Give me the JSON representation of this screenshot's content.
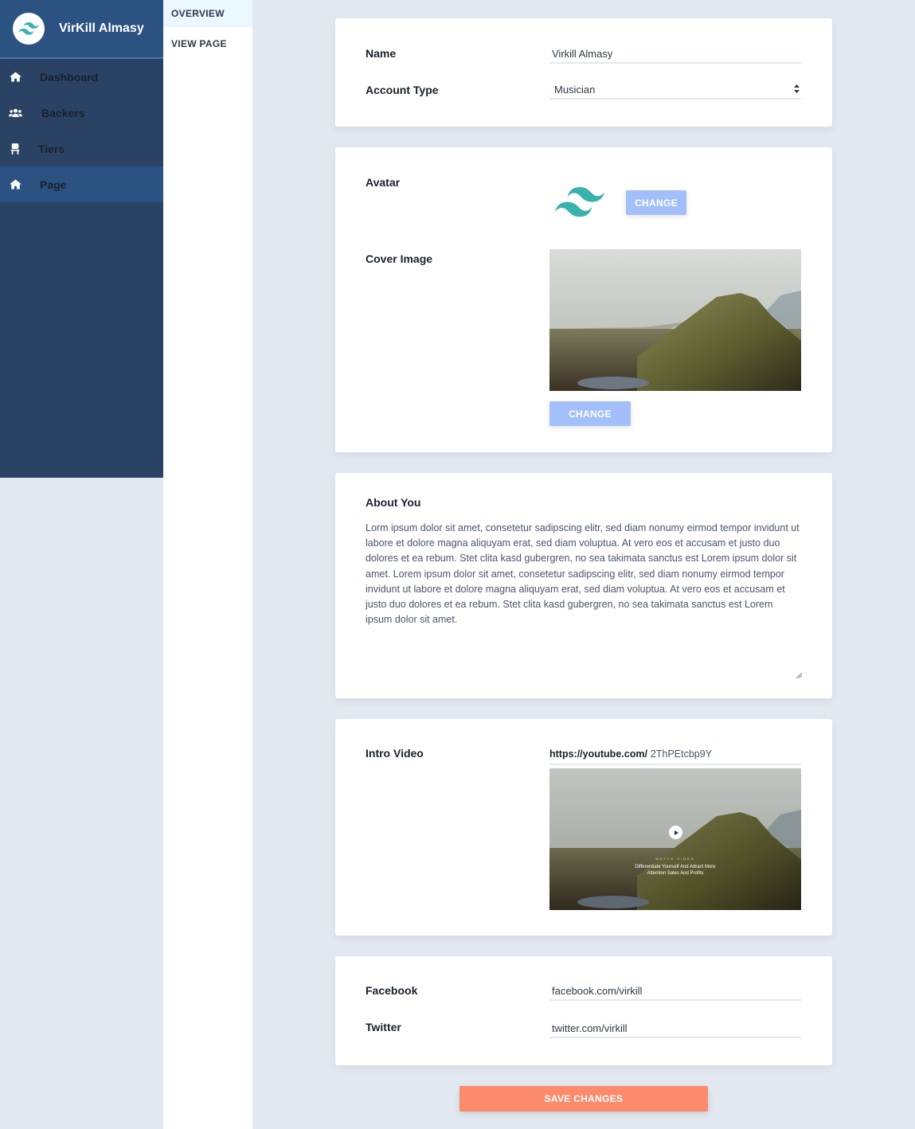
{
  "brand": {
    "name": "VirKill Almasy"
  },
  "sidebar": {
    "items": [
      {
        "label": "Dashboard",
        "icon": "home-icon"
      },
      {
        "label": "Backers",
        "icon": "users-icon"
      },
      {
        "label": "Tiers",
        "icon": "chair-icon"
      },
      {
        "label": "Page",
        "icon": "home-icon",
        "active": true
      }
    ]
  },
  "subnav": {
    "items": [
      {
        "label": "OVERVIEW",
        "active": true
      },
      {
        "label": "VIEW PAGE"
      }
    ]
  },
  "account": {
    "name_label": "Name",
    "name_value": "Virkill Almasy",
    "type_label": "Account Type",
    "type_value": "Musician"
  },
  "media": {
    "avatar_label": "Avatar",
    "avatar_change": "CHANGE",
    "cover_label": "Cover Image",
    "cover_change": "CHANGE"
  },
  "about": {
    "label": "About You",
    "text": "Lorm ipsum dolor sit amet, consetetur sadipscing elitr, sed diam nonumy eirmod tempor invidunt ut labore et dolore magna aliquyam erat, sed diam voluptua. At vero eos et accusam et justo duo dolores et ea rebum. Stet clita kasd gubergren, no sea takimata sanctus est Lorem ipsum dolor sit amet. Lorem ipsum dolor sit amet, consetetur sadipscing elitr, sed diam nonumy eirmod tempor invidunt ut labore et dolore magna aliquyam erat, sed diam voluptua. At vero eos et accusam et justo duo dolores et ea rebum. Stet clita kasd gubergren, no sea takimata sanctus est Lorem ipsum dolor sit amet."
  },
  "video": {
    "label": "Intro Video",
    "url_prefix": "https://youtube.com/",
    "url_value": "2ThPEtcbp9Y",
    "overlay_kicker": "WATCH VIDEO",
    "overlay_line1": "Differentiate Yourself And Attract More",
    "overlay_line2": "Attention Sales And Profits"
  },
  "social": {
    "facebook_label": "Facebook",
    "facebook_value": "facebook.com/virkill",
    "twitter_label": "Twitter",
    "twitter_value": "twitter.com/virkill"
  },
  "actions": {
    "save": "SAVE CHANGES"
  },
  "colors": {
    "sidebar": "#2a4365",
    "sidebar_active": "#2c5282",
    "button": "#a3bffa",
    "save": "#fc8a6b",
    "brand_logo": "#38b2ac"
  }
}
